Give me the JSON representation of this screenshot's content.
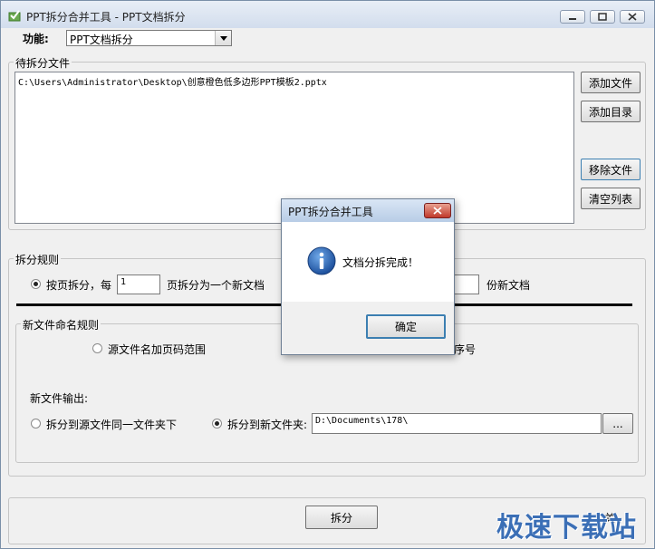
{
  "window": {
    "title": "PPT拆分合并工具 - PPT文档拆分"
  },
  "function_select": {
    "label": "功能:",
    "value": "PPT文档拆分"
  },
  "file_group": {
    "title": "待拆分文件",
    "files": [
      "C:\\Users\\Administrator\\Desktop\\创意橙色低多边形PPT模板2.pptx"
    ],
    "buttons": {
      "add_file": "添加文件",
      "add_dir": "添加目录",
      "remove_file": "移除文件",
      "clear_list": "清空列表"
    }
  },
  "rules_group": {
    "title": "拆分规则",
    "by_page_label": "按页拆分，每",
    "pages_value": "1",
    "by_page_suffix": "页拆分为一个新文档",
    "count_suffix": "份新文档"
  },
  "naming_group": {
    "title": "新文件命名规则",
    "option_page_range": "源文件名加页码范围",
    "option_sequence_tail": "序号"
  },
  "output": {
    "label": "新文件输出:",
    "option_same_folder": "拆分到源文件同一文件夹下",
    "option_new_folder": "拆分到新文件夹:",
    "folder_value": "D:\\Documents\\178\\",
    "browse_label": "..."
  },
  "footer": {
    "split_button": "拆分",
    "close_partial": "关"
  },
  "dialog": {
    "title": "PPT拆分合并工具",
    "message": "文档分拆完成！",
    "ok_button": "确定"
  },
  "watermark": "极速下载站"
}
